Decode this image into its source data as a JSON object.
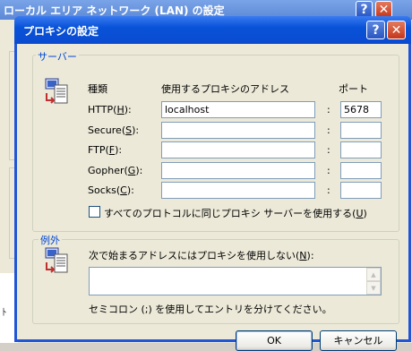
{
  "background_window": {
    "title": "ローカル エリア ネットワーク (LAN) の設定",
    "bottom_text": "ﾄ"
  },
  "dialog": {
    "title": "プロキシの設定",
    "help_glyph": "?",
    "close_glyph": "✕"
  },
  "servers": {
    "legend": "サーバー",
    "col_type": "種類",
    "col_address": "使用するプロキシのアドレス",
    "col_port": "ポート",
    "colon": ":",
    "rows": [
      {
        "label_pre": "HTTP(",
        "key": "H",
        "label_post": "):",
        "address": "localhost",
        "port": "5678"
      },
      {
        "label_pre": "Secure(",
        "key": "S",
        "label_post": "):",
        "address": "",
        "port": ""
      },
      {
        "label_pre": "FTP(",
        "key": "F",
        "label_post": "):",
        "address": "",
        "port": ""
      },
      {
        "label_pre": "Gopher(",
        "key": "G",
        "label_post": "):",
        "address": "",
        "port": ""
      },
      {
        "label_pre": "Socks(",
        "key": "C",
        "label_post": "):",
        "address": "",
        "port": ""
      }
    ],
    "same_proxy_pre": "すべてのプロトコルに同じプロキシ サーバーを使用する(",
    "same_proxy_key": "U",
    "same_proxy_post": ")",
    "same_proxy_checked": false
  },
  "exceptions": {
    "legend": "例外",
    "prompt_pre": "次で始まるアドレスにはプロキシを使用しない(",
    "prompt_key": "N",
    "prompt_post": "):",
    "value": "",
    "hint": "セミコロン (;) を使用してエントリを分けてください。"
  },
  "buttons": {
    "ok": "OK",
    "cancel": "キャンセル"
  },
  "colors": {
    "title_blue": "#0853d8",
    "legend_blue": "#0046d5",
    "close_red": "#c6361a"
  }
}
